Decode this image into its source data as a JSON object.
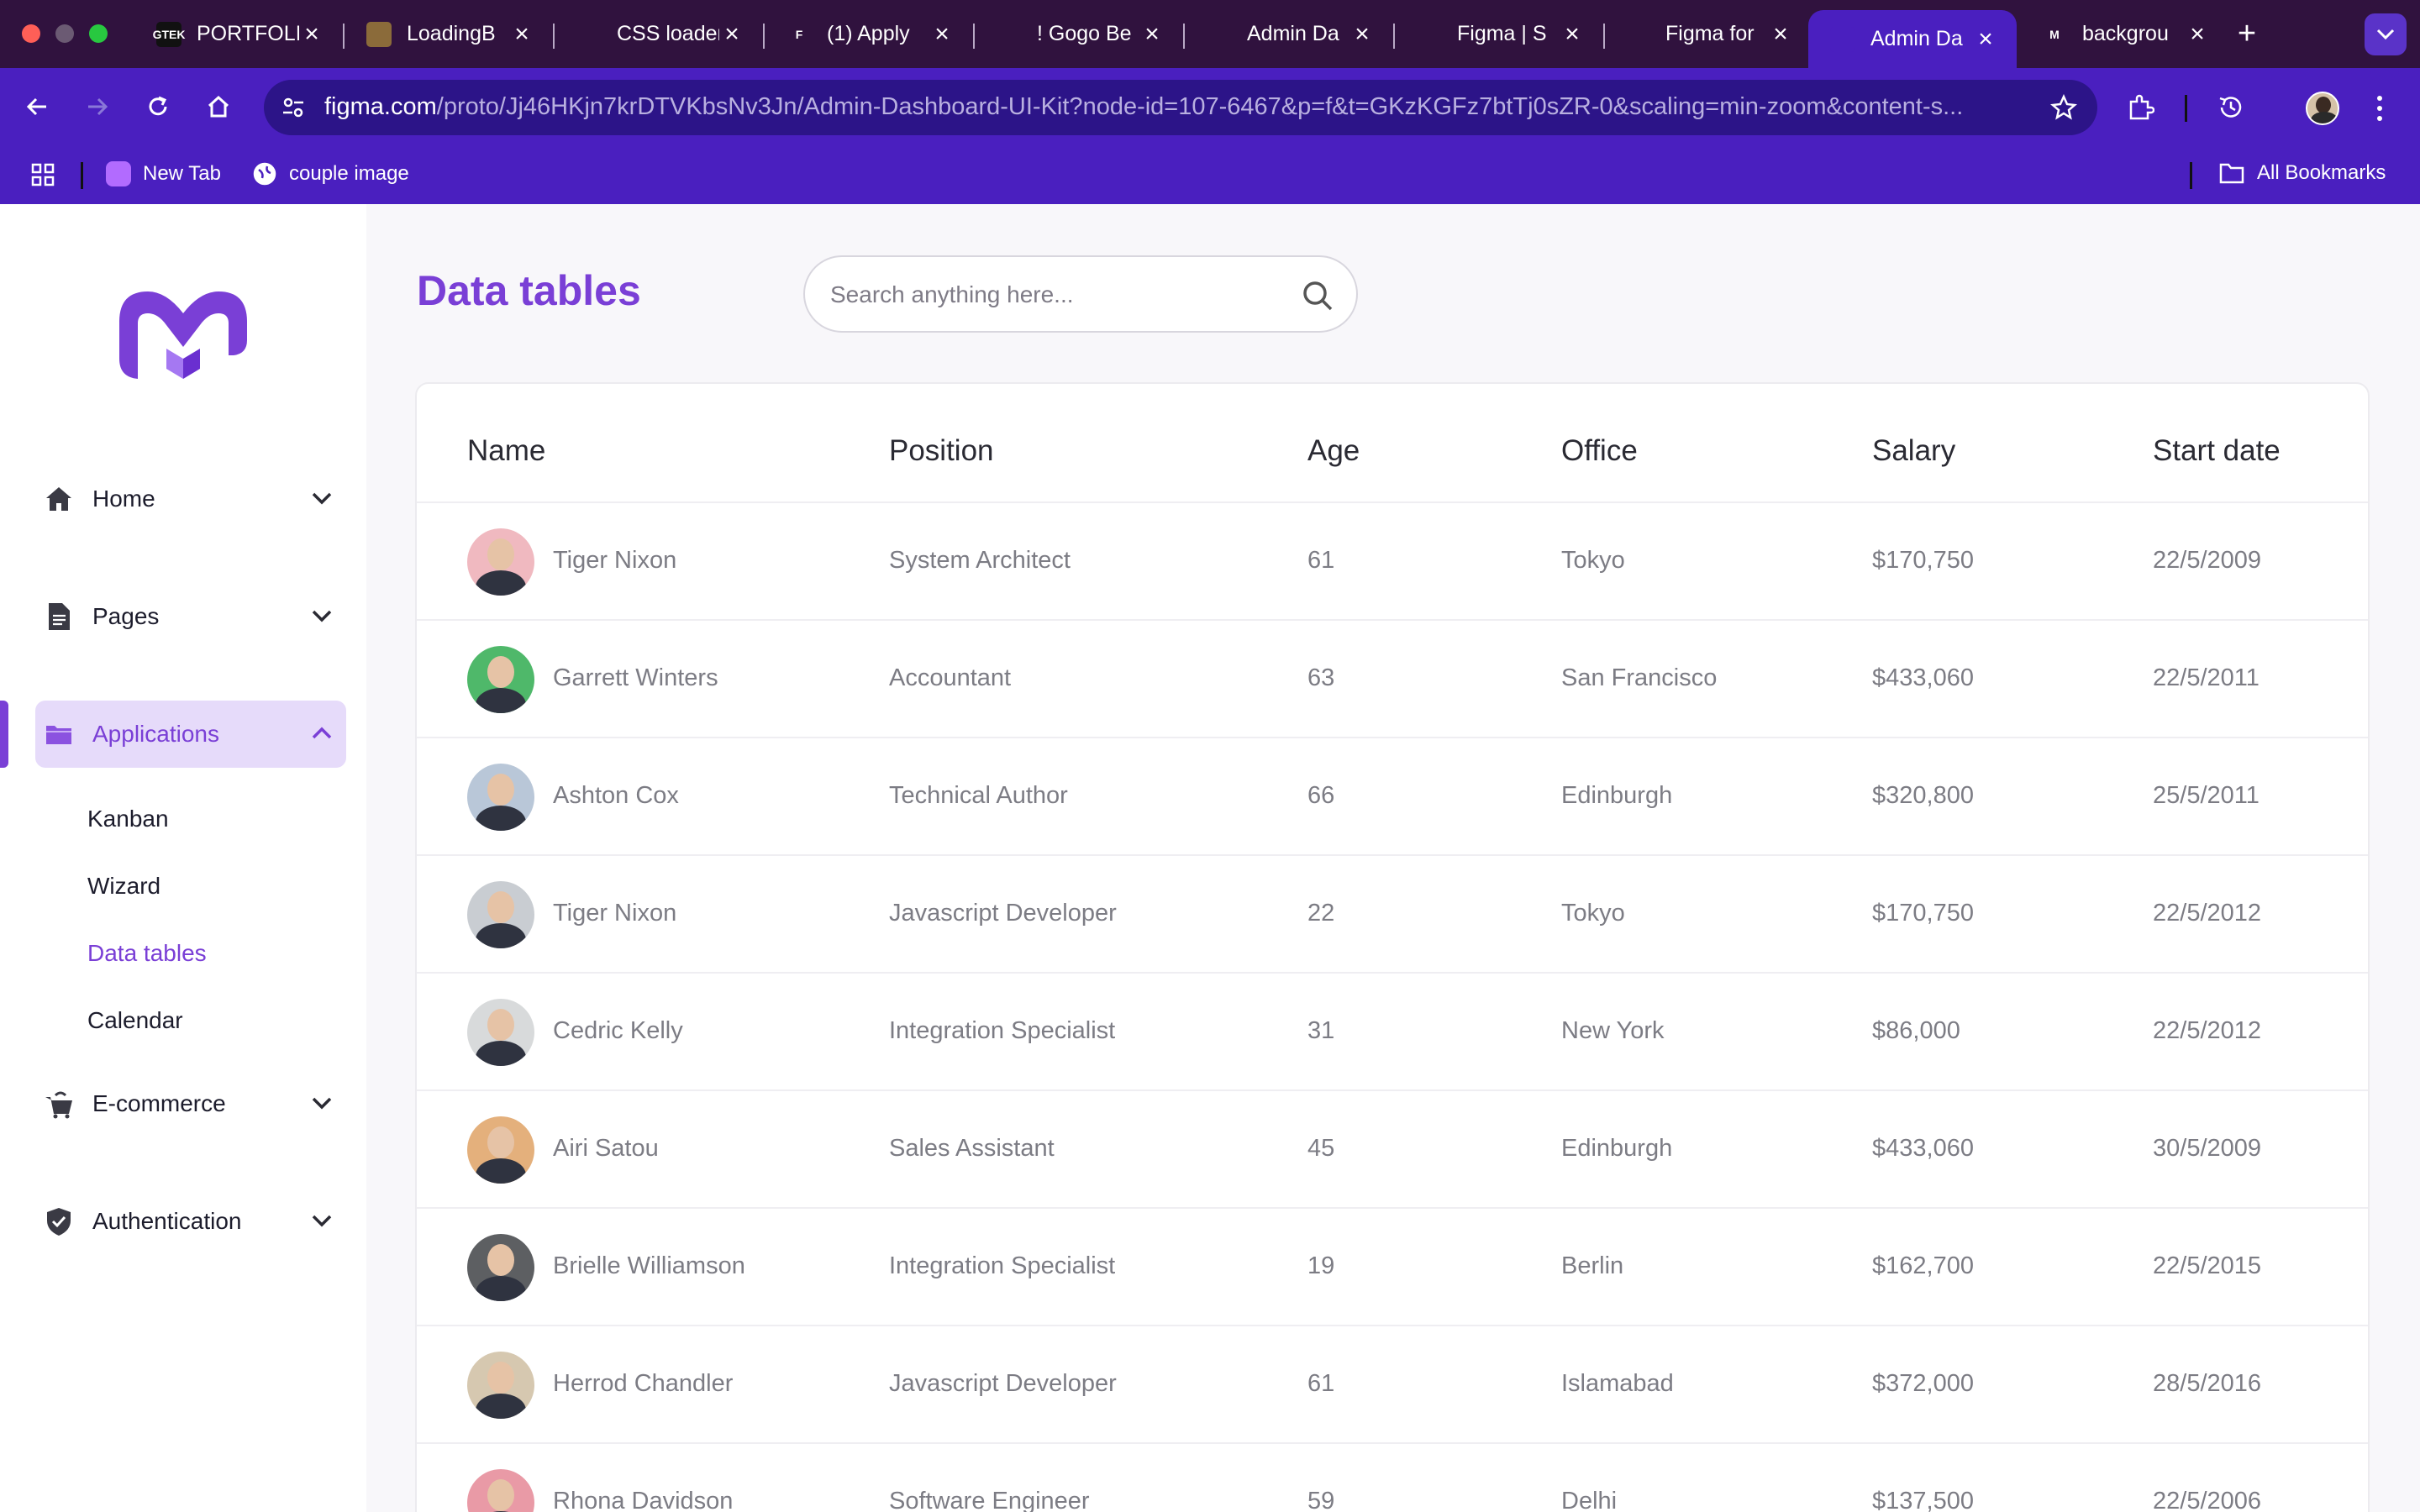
{
  "browser": {
    "tabs": [
      {
        "title": "PORTFOLIO",
        "fav": "GTEK",
        "fav_bg": "#111111"
      },
      {
        "title": "LoadingB",
        "fav": "",
        "fav_bg": "#8b6b3a"
      },
      {
        "title": "CSS loader",
        "fav": "",
        "fav_bg": "#30123e"
      },
      {
        "title": "(1) Apply",
        "fav": "F",
        "fav_bg": "#30123e"
      },
      {
        "title": "! Gogo Be",
        "fav": "",
        "fav_bg": "#30123e"
      },
      {
        "title": "Admin Da",
        "fav": "",
        "fav_bg": "#30123e"
      },
      {
        "title": "Figma | S",
        "fav": "",
        "fav_bg": "#30123e"
      },
      {
        "title": "Figma for",
        "fav": "",
        "fav_bg": "#30123e"
      },
      {
        "title": "Admin Da",
        "fav": "",
        "fav_bg": "#4a1fbf",
        "active": true
      },
      {
        "title": "backgrou",
        "fav": "M",
        "fav_bg": "#30123e"
      }
    ],
    "url_host": "figma.com",
    "url_path": "/proto/Jj46HKjn7krDTVKbsNv3Jn/Admin-Dashboard-UI-Kit?node-id=107-6467&p=f&t=GKzKGFz7btTj0sZR-0&scaling=min-zoom&content-s...",
    "bookmarks": [
      {
        "label": "New Tab"
      },
      {
        "label": "couple image"
      }
    ],
    "all_bookmarks": "All Bookmarks"
  },
  "sidebar": {
    "items": [
      {
        "label": "Home",
        "icon": "home-icon"
      },
      {
        "label": "Pages",
        "icon": "document-icon"
      },
      {
        "label": "Applications",
        "icon": "folder-icon",
        "active": true
      },
      {
        "label": "E-commerce",
        "icon": "cart-icon"
      },
      {
        "label": "Authentication",
        "icon": "shield-icon"
      }
    ],
    "subitems": [
      {
        "label": "Kanban"
      },
      {
        "label": "Wizard"
      },
      {
        "label": "Data tables",
        "active": true
      },
      {
        "label": "Calendar"
      }
    ]
  },
  "main": {
    "title": "Data tables",
    "search_placeholder": "Search anything here...",
    "columns": [
      "Name",
      "Position",
      "Age",
      "Office",
      "Salary",
      "Start date"
    ],
    "rows": [
      {
        "name": "Tiger Nixon",
        "position": "System Architect",
        "age": "61",
        "office": "Tokyo",
        "salary": "$170,750",
        "start": "22/5/2009",
        "avatar_bg": "#f0b9c0"
      },
      {
        "name": "Garrett Winters",
        "position": "Accountant",
        "age": "63",
        "office": "San Francisco",
        "salary": "$433,060",
        "start": "22/5/2011",
        "avatar_bg": "#4fb86a"
      },
      {
        "name": "Ashton Cox",
        "position": "Technical Author",
        "age": "66",
        "office": "Edinburgh",
        "salary": "$320,800",
        "start": "25/5/2011",
        "avatar_bg": "#b9c7d8"
      },
      {
        "name": "Tiger Nixon",
        "position": "Javascript Developer",
        "age": "22",
        "office": "Tokyo",
        "salary": "$170,750",
        "start": "22/5/2012",
        "avatar_bg": "#c9cdd2"
      },
      {
        "name": "Cedric Kelly",
        "position": "Integration Specialist",
        "age": "31",
        "office": "New York",
        "salary": "$86,000",
        "start": "22/5/2012",
        "avatar_bg": "#d8dadb"
      },
      {
        "name": "Airi Satou",
        "position": "Sales Assistant",
        "age": "45",
        "office": "Edinburgh",
        "salary": "$433,060",
        "start": "30/5/2009",
        "avatar_bg": "#e4b07c"
      },
      {
        "name": "Brielle Williamson",
        "position": "Integration Specialist",
        "age": "19",
        "office": "Berlin",
        "salary": "$162,700",
        "start": "22/5/2015",
        "avatar_bg": "#5d5f62"
      },
      {
        "name": "Herrod Chandler",
        "position": "Javascript Developer",
        "age": "61",
        "office": "Islamabad",
        "salary": "$372,000",
        "start": "28/5/2016",
        "avatar_bg": "#d6c8b0"
      },
      {
        "name": "Rhona Davidson",
        "position": "Software Engineer",
        "age": "59",
        "office": "Delhi",
        "salary": "$137,500",
        "start": "22/5/2006",
        "avatar_bg": "#e99aa6"
      }
    ]
  }
}
